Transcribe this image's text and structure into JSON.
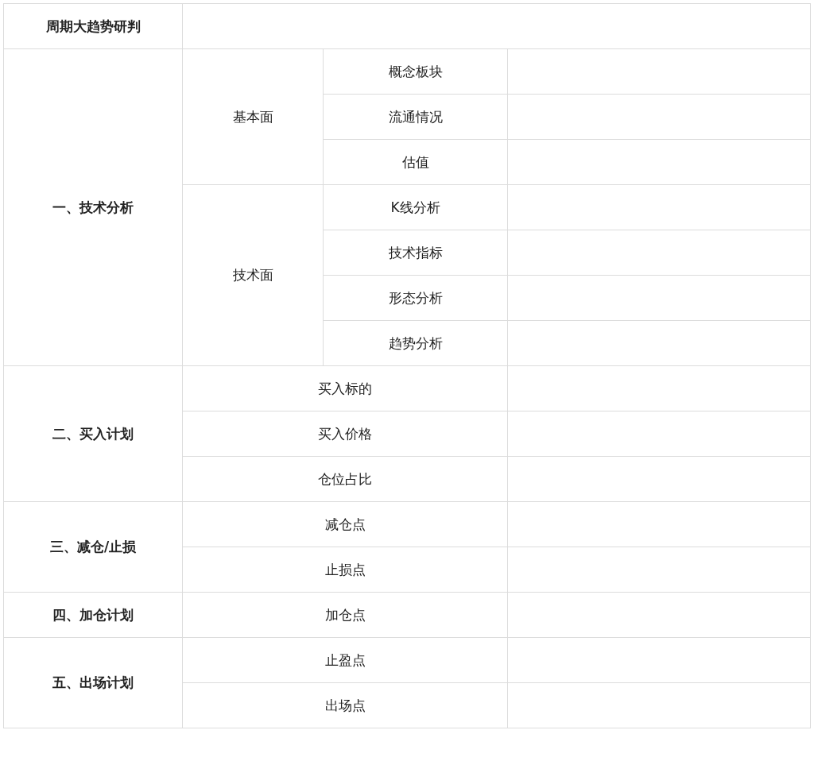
{
  "header": {
    "title": "周期大趋势研判"
  },
  "sections": [
    {
      "title": "一、技术分析",
      "kind": "grouped",
      "groups": [
        {
          "title": "基本面",
          "items": [
            "概念板块",
            "流通情况",
            "估值"
          ]
        },
        {
          "title": "技术面",
          "items": [
            "K线分析",
            "技术指标",
            "形态分析",
            "趋势分析"
          ]
        }
      ]
    },
    {
      "title": "二、买入计划",
      "kind": "flat",
      "items": [
        "买入标的",
        "买入价格",
        "仓位占比"
      ]
    },
    {
      "title": "三、减仓/止损",
      "kind": "flat",
      "items": [
        "减仓点",
        "止损点"
      ]
    },
    {
      "title": "四、加仓计划",
      "kind": "flat",
      "items": [
        "加仓点"
      ]
    },
    {
      "title": "五、出场计划",
      "kind": "flat",
      "items": [
        "止盈点",
        "出场点"
      ]
    }
  ]
}
